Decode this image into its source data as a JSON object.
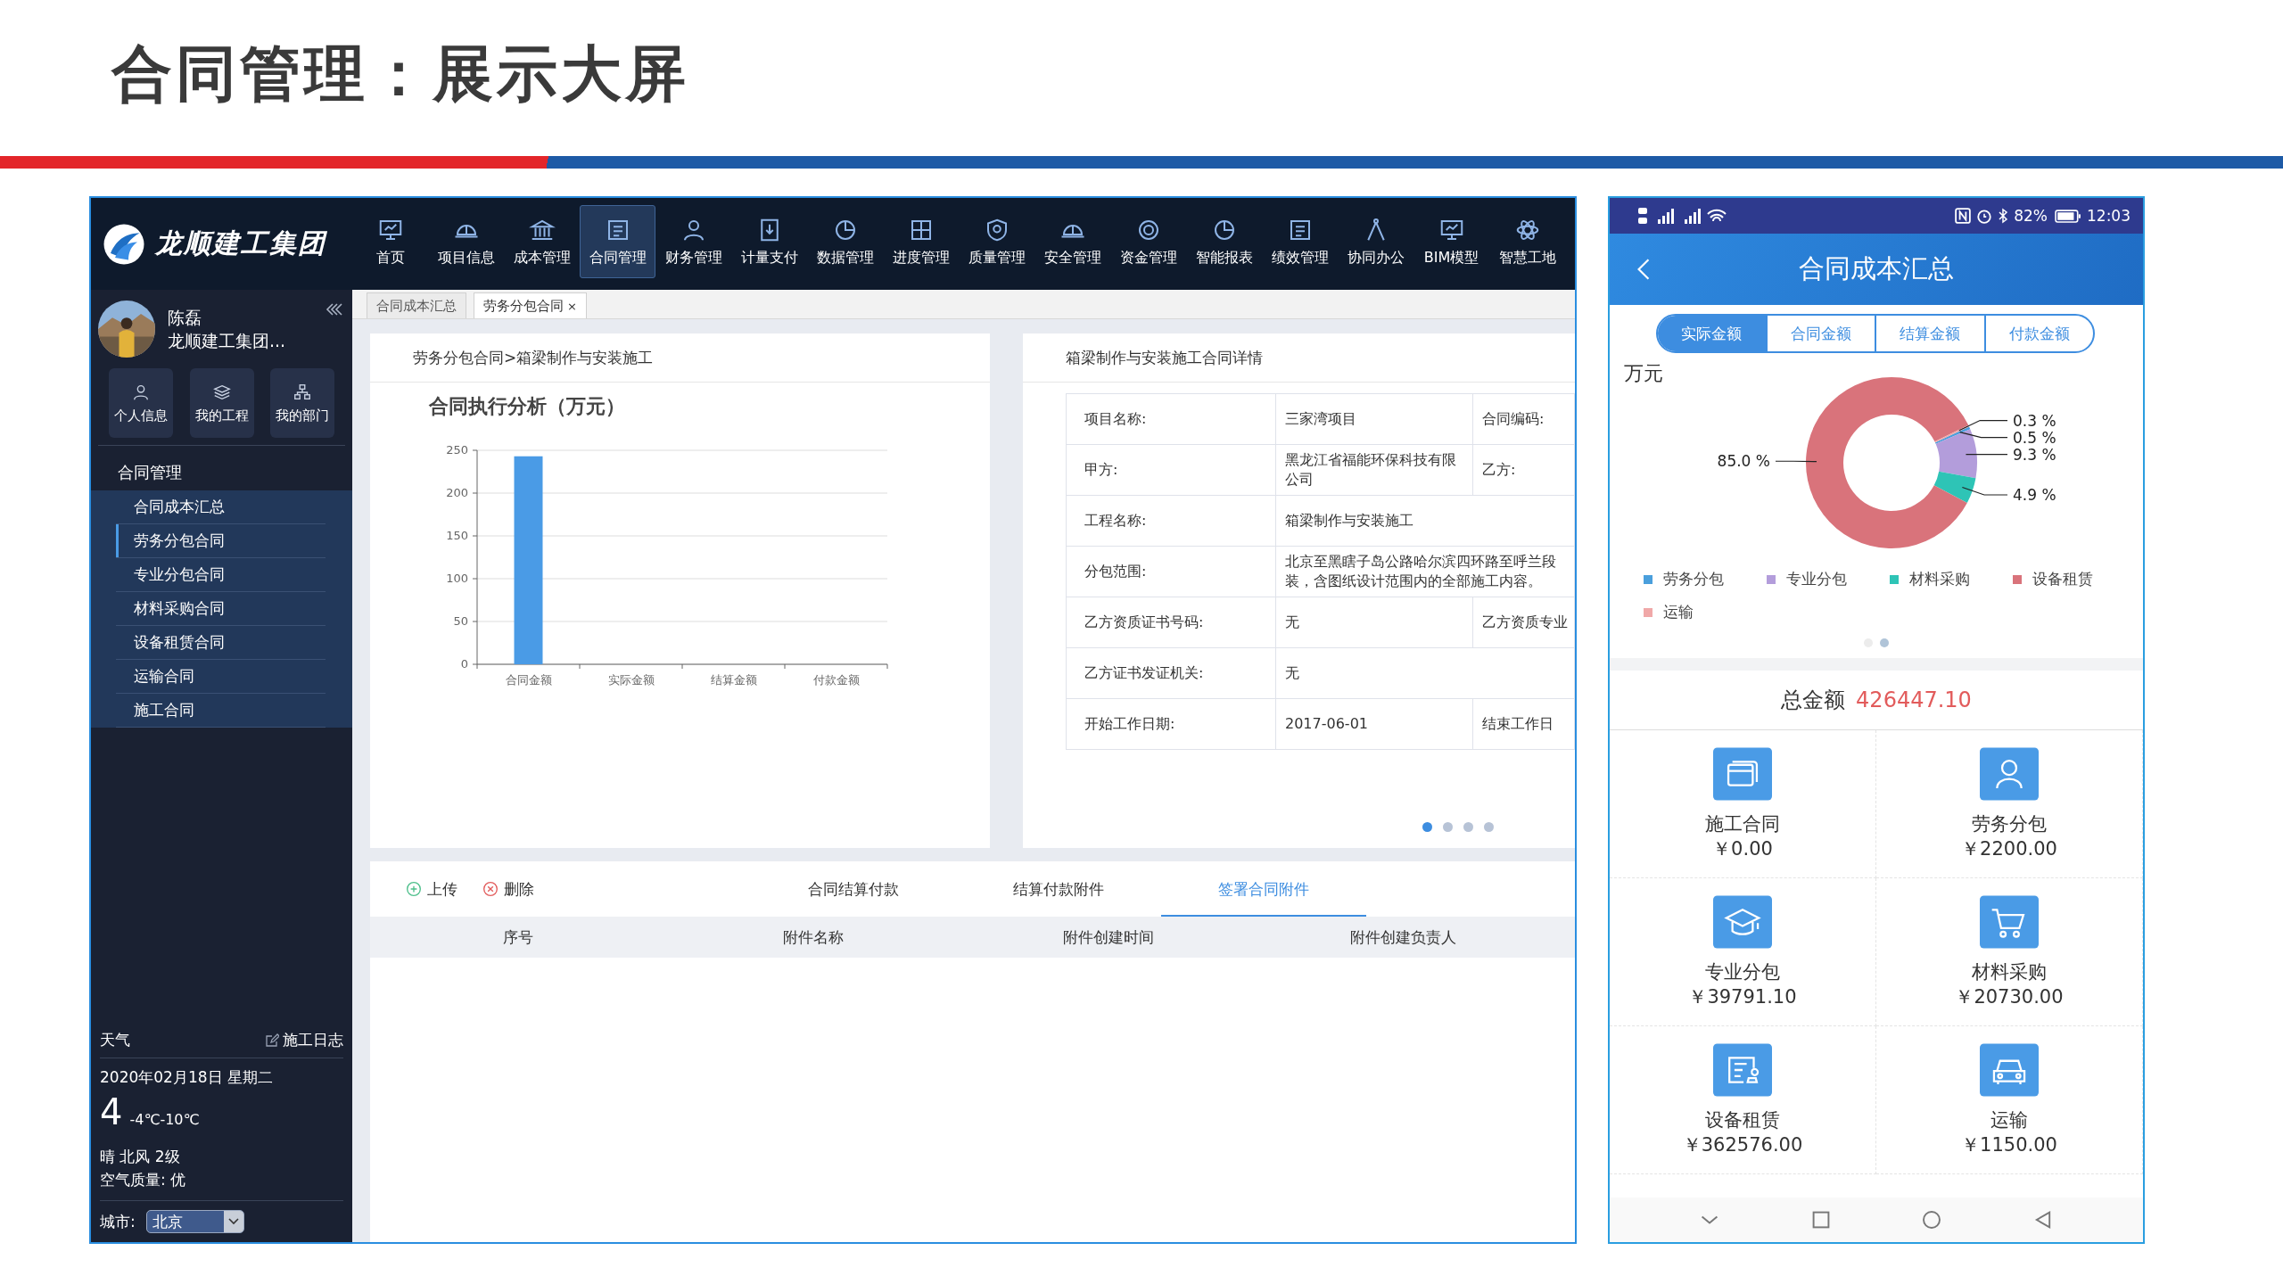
{
  "slide": {
    "title": "合同管理：展示大屏"
  },
  "web_app": {
    "brand": "龙顺建工集团",
    "nav": [
      {
        "label": "首页",
        "kind": "monitor",
        "selected": false
      },
      {
        "label": "项目信息",
        "kind": "helmet",
        "selected": false
      },
      {
        "label": "成本管理",
        "kind": "bank",
        "selected": false
      },
      {
        "label": "合同管理",
        "kind": "document",
        "selected": true
      },
      {
        "label": "财务管理",
        "kind": "person",
        "selected": false
      },
      {
        "label": "计量支付",
        "kind": "download",
        "selected": false
      },
      {
        "label": "数据管理",
        "kind": "chart",
        "selected": false
      },
      {
        "label": "进度管理",
        "kind": "grid",
        "selected": false
      },
      {
        "label": "质量管理",
        "kind": "shield",
        "selected": false
      },
      {
        "label": "安全管理",
        "kind": "helmet",
        "selected": false
      },
      {
        "label": "资金管理",
        "kind": "coin",
        "selected": false
      },
      {
        "label": "智能报表",
        "kind": "chart",
        "selected": false
      },
      {
        "label": "绩效管理",
        "kind": "document",
        "selected": false
      },
      {
        "label": "协同办公",
        "kind": "compass",
        "selected": false
      },
      {
        "label": "BIM模型",
        "kind": "monitor",
        "selected": false
      },
      {
        "label": "智慧工地",
        "kind": "atom",
        "selected": false
      }
    ],
    "user": {
      "name": "陈磊",
      "org": "龙顺建工集团..."
    },
    "quick_links": [
      {
        "label": "个人信息",
        "kind": "person"
      },
      {
        "label": "我的工程",
        "kind": "layers"
      },
      {
        "label": "我的部门",
        "kind": "org"
      }
    ],
    "menu": {
      "title": "合同管理",
      "items": [
        {
          "label": "合同成本汇总",
          "selected": false
        },
        {
          "label": "劳务分包合同",
          "selected": true
        },
        {
          "label": "专业分包合同",
          "selected": false
        },
        {
          "label": "材料采购合同",
          "selected": false
        },
        {
          "label": "设备租赁合同",
          "selected": false
        },
        {
          "label": "运输合同",
          "selected": false
        },
        {
          "label": "施工合同",
          "selected": false
        }
      ]
    },
    "weather": {
      "title": "天气",
      "log_link": "施工日志",
      "date": "2020年02月18日  星期二",
      "temperature": "4",
      "range": "-4℃-10℃",
      "condition": "晴  北风 2级",
      "air": "空气质量: 优",
      "city_label": "城市:",
      "city": "北京"
    },
    "tabs": [
      {
        "label": "合同成本汇总",
        "selected": false
      },
      {
        "label": "劳务分包合同",
        "selected": true,
        "close": "×"
      }
    ],
    "chart_panel": {
      "breadcrumb": "劳务分包合同>箱梁制作与安装施工",
      "chart_data": {
        "type": "bar",
        "title": "合同执行分析（万元）",
        "categories": [
          "合同金额",
          "实际金额",
          "结算金额",
          "付款金额"
        ],
        "values": [
          243,
          0,
          0,
          0
        ],
        "ylim": [
          0,
          250
        ],
        "yticks": [
          0,
          50,
          100,
          150,
          200,
          250
        ],
        "grid": true
      }
    },
    "detail_panel": {
      "title": "箱梁制作与安装施工合同详情",
      "fields": [
        {
          "label": "项目名称:",
          "value": "三家湾项目",
          "next_label": "合同编码:"
        },
        {
          "label": "甲方:",
          "value": "黑龙江省福能环保科技有限公司",
          "next_label": "乙方:"
        },
        {
          "label": "工程名称:",
          "value": "箱梁制作与安装施工"
        },
        {
          "label": "分包范围:",
          "value": "北京至黑瞎子岛公路哈尔滨四环路至呼兰段装，含图纸设计范围内的全部施工内容。"
        },
        {
          "label": "乙方资质证书号码:",
          "value": "无",
          "next_label": "乙方资质专业"
        },
        {
          "label": "乙方证书发证机关:",
          "value": "无"
        },
        {
          "label": "开始工作日期:",
          "value": "2017-06-01",
          "next_label": "结束工作日"
        }
      ],
      "pages": [
        {
          "selected": true
        },
        {
          "selected": false
        },
        {
          "selected": false
        },
        {
          "selected": false
        }
      ]
    },
    "attachments": {
      "actions": [
        {
          "label": "上传",
          "kind": "upload"
        },
        {
          "label": "删除",
          "kind": "delete"
        }
      ],
      "tabs": [
        {
          "label": "合同结算付款",
          "selected": false
        },
        {
          "label": "结算付款附件",
          "selected": false
        },
        {
          "label": "签署合同附件",
          "selected": true
        }
      ],
      "columns": [
        "序号",
        "附件名称",
        "附件创建时间",
        "附件创建负责人"
      ]
    }
  },
  "phone": {
    "status": {
      "battery_text": "82%",
      "time": "12:03"
    },
    "title": "合同成本汇总",
    "segments": [
      {
        "label": "实际金额",
        "selected": true
      },
      {
        "label": "合同金额",
        "selected": false
      },
      {
        "label": "结算金额",
        "selected": false
      },
      {
        "label": "付款金额",
        "selected": false
      }
    ],
    "unit": "万元",
    "chart_data": {
      "type": "donut",
      "categories": [
        "劳务分包",
        "专业分包",
        "材料采购",
        "设备租赁",
        "运输"
      ],
      "values": [
        0.5,
        9.3,
        4.9,
        85.0,
        0.3
      ],
      "colors": [
        "#4a9fdc",
        "#b39ddb",
        "#2ec4b6",
        "#d9737b",
        "#f0a8a8"
      ],
      "value_labels": [
        "0.5 %",
        "9.3 %",
        "4.9 %",
        "85.0 %",
        "0.3 %"
      ]
    },
    "pages": [
      {
        "selected": false
      },
      {
        "selected": true
      }
    ],
    "total_label": "总金额",
    "total": "426447.10",
    "items": [
      {
        "label": "施工合同",
        "amount": "￥0.00",
        "kind": "windows"
      },
      {
        "label": "劳务分包",
        "amount": "￥2200.00",
        "kind": "person"
      },
      {
        "label": "专业分包",
        "amount": "￥39791.10",
        "kind": "cap"
      },
      {
        "label": "材料采购",
        "amount": "￥20730.00",
        "kind": "cart"
      },
      {
        "label": "设备租赁",
        "amount": "￥362576.00",
        "kind": "certificate"
      },
      {
        "label": "运输",
        "amount": "￥1150.00",
        "kind": "car"
      }
    ]
  }
}
